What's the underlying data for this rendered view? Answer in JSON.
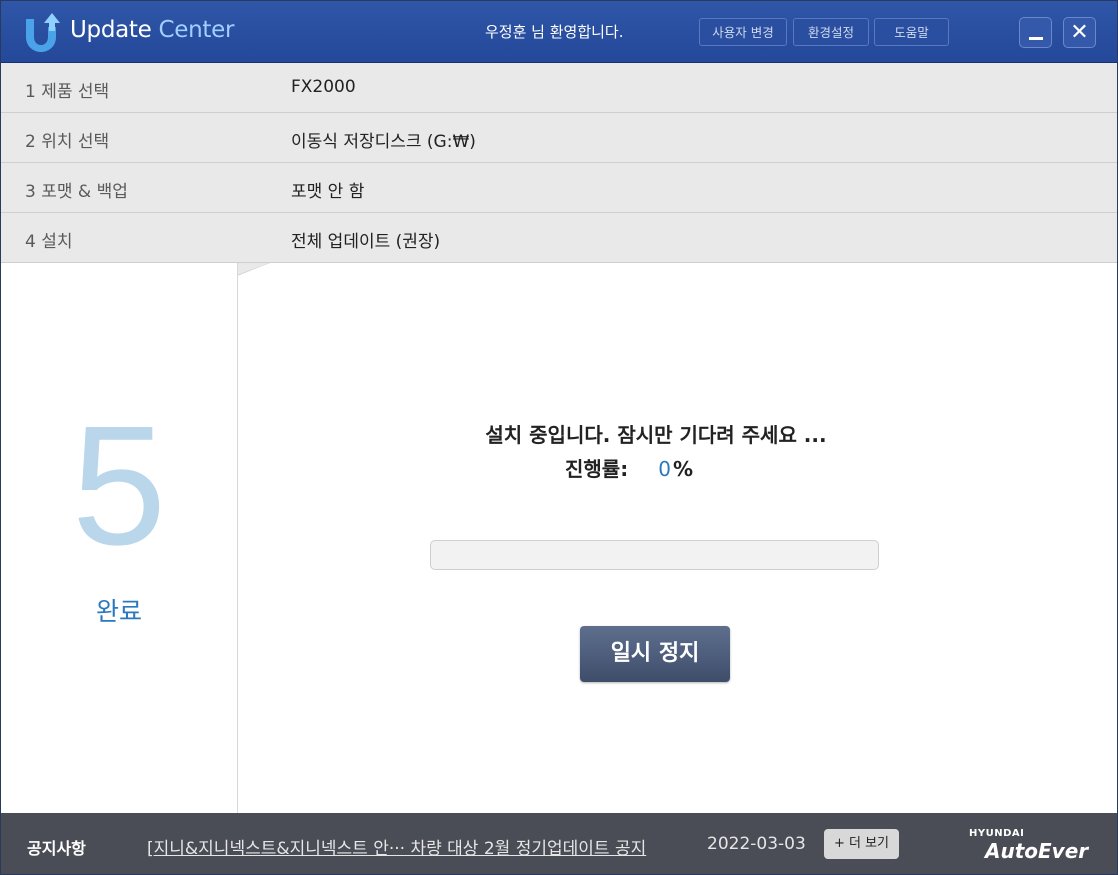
{
  "app": {
    "title_part1": "Update",
    "title_part2": "Center",
    "welcome": "우정훈  님 환영합니다.",
    "buttons": {
      "change_user": "사용자 변경",
      "settings": "환경설정",
      "help": "도움말"
    }
  },
  "steps": [
    {
      "label": "1  제품 선택",
      "value": "FX2000"
    },
    {
      "label": "2  위치 선택",
      "value": "이동식 저장디스크 (G:₩)"
    },
    {
      "label": "3  포맷 & 백업",
      "value": "포맷 안 함"
    },
    {
      "label": "4  설치",
      "value": "전체 업데이트 (권장)"
    }
  ],
  "current_step": {
    "number": "5",
    "label": "완료"
  },
  "install": {
    "status": "설치 중입니다. 잠시만 기다려 주세요 ...",
    "progress_label": "진행률:",
    "progress_value": "0",
    "progress_symbol": "%",
    "progress_fraction": 0,
    "pause_label": "일시 정지"
  },
  "footer": {
    "notice_label": "공지사항",
    "notice_text": "[지니&지니넥스트&지니넥스트  안··· 차량 대상 2월 정기업데이트 공지",
    "notice_date": "2022-03-03",
    "more_label": "+ 더 보기",
    "brand_small": "HYUNDAI",
    "brand_main": "AutoEver"
  },
  "colors": {
    "titlebar": "#2f56a8",
    "accent": "#2a78c0",
    "step_bg": "#e9e9e9",
    "footer_bg": "#4a4d55",
    "pause_button": "#4e5d7c"
  },
  "icons": {
    "logo": "update-arrow-logo-icon",
    "minimize": "minimize-icon",
    "close": "close-icon"
  }
}
